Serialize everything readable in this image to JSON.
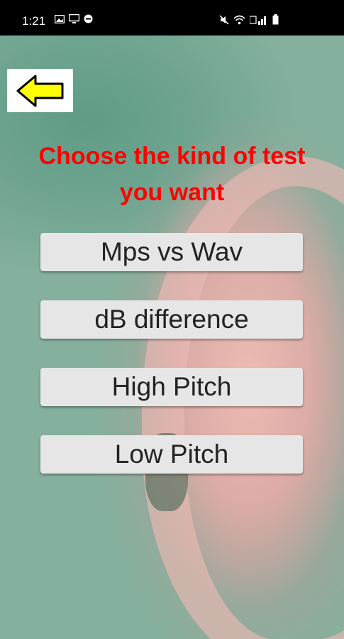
{
  "status_bar": {
    "time": "1:21",
    "left_icons": [
      "image-icon",
      "screen-icon",
      "chat-icon"
    ],
    "right_icons": [
      "mute-icon",
      "wifi-icon",
      "signal-icon",
      "battery-icon"
    ]
  },
  "back_icon": "arrow-left-icon",
  "heading": {
    "line1": "Choose the kind of test",
    "line2": "you want"
  },
  "menu": {
    "option1": "Mps vs Wav",
    "option2": "dB difference",
    "option3": "High Pitch",
    "option4": "Low Pitch"
  },
  "colors": {
    "heading": "#ff0000",
    "button_bg": "#e6e6e6",
    "arrow_fill": "#ffff00"
  }
}
